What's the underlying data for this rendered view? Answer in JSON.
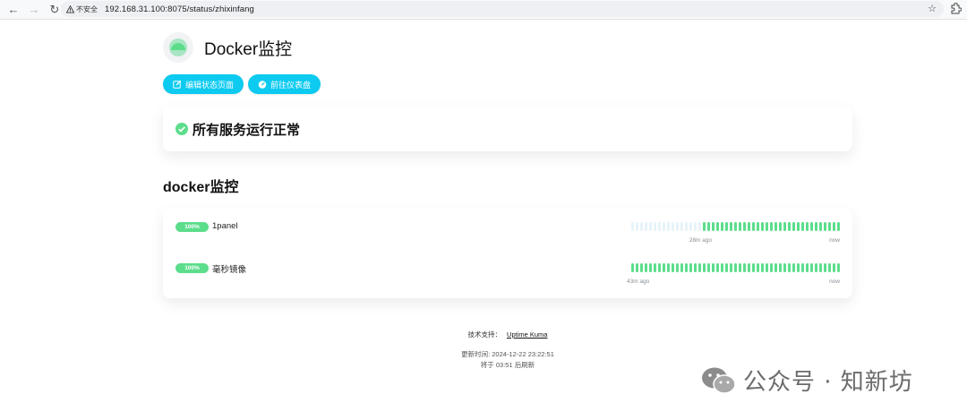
{
  "browser": {
    "back_icon": "arrow-left-icon",
    "forward_icon": "arrow-right-icon",
    "reload_icon": "reload-icon",
    "security_label": "不安全",
    "url": "192.168.31.100:8075/status/zhixinfang"
  },
  "page": {
    "title": "Docker监控",
    "buttons": {
      "edit": "编辑状态页面",
      "dashboard": "前往仪表盘"
    },
    "overall_status": "所有服务运行正常"
  },
  "group": {
    "name": "docker监控",
    "monitors": [
      {
        "uptime": "100%",
        "name": "1panel",
        "time_start": "28m ago",
        "time_end": "now",
        "filled_beats": 31,
        "empty_beats": 16
      },
      {
        "uptime": "100%",
        "name": "毫秒镜像",
        "time_start": "43m ago",
        "time_end": "now",
        "filled_beats": 47,
        "empty_beats": 0
      }
    ]
  },
  "footer": {
    "support_label": "技术支持：",
    "support_link": "Uptime Kuma",
    "updated": "更新时间: 2024-12-22 23:22:51",
    "refresh": "将于 03:51 后刷新"
  },
  "watermark": {
    "text": "公众号 · 知新坊"
  },
  "colors": {
    "accent": "#0dcaf0",
    "up": "#5cdd8b",
    "empty_beat": "#e7f3f8"
  }
}
